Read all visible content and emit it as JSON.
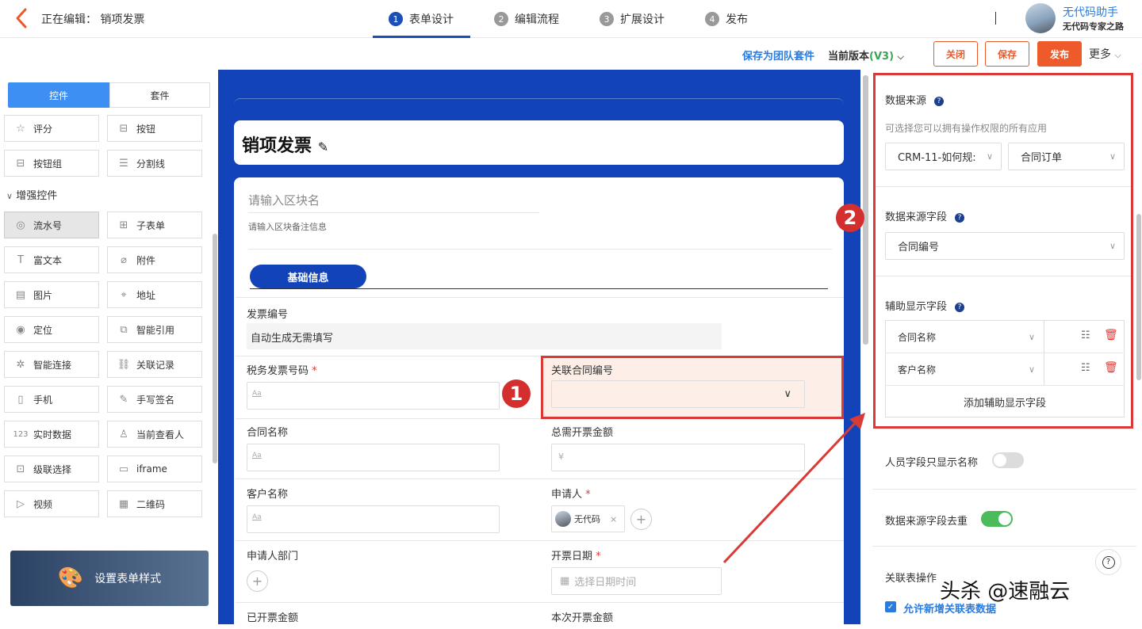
{
  "header": {
    "editing_label": "正在编辑：",
    "form_name": "销项发票",
    "steps": [
      {
        "num": "1",
        "label": "表单设计",
        "active": true
      },
      {
        "num": "2",
        "label": "编辑流程"
      },
      {
        "num": "3",
        "label": "扩展设计"
      },
      {
        "num": "4",
        "label": "发布"
      }
    ],
    "user_name": "无代码助手",
    "user_role": "无代码专家之路"
  },
  "toolbar": {
    "save_suite": "保存为团队套件",
    "version_label": "当前版本",
    "version_value": "(V3)",
    "close": "关闭",
    "save": "保存",
    "publish": "发布",
    "more": "更多"
  },
  "left_panel": {
    "tabs": [
      "控件",
      "套件"
    ],
    "top_items": [
      {
        "label": "评分",
        "icon": "star-icon"
      },
      {
        "label": "按钮",
        "icon": "button-icon"
      },
      {
        "label": "按钮组",
        "icon": "button-group-icon"
      },
      {
        "label": "分割线",
        "icon": "divider-icon"
      }
    ],
    "group_title": "增强控件",
    "items": [
      {
        "label": "流水号",
        "icon": "serial-icon"
      },
      {
        "label": "子表单",
        "icon": "subform-icon"
      },
      {
        "label": "富文本",
        "icon": "richtext-icon"
      },
      {
        "label": "附件",
        "icon": "attachment-icon"
      },
      {
        "label": "图片",
        "icon": "image-icon"
      },
      {
        "label": "地址",
        "icon": "address-icon"
      },
      {
        "label": "定位",
        "icon": "location-icon"
      },
      {
        "label": "智能引用",
        "icon": "smart-ref-icon"
      },
      {
        "label": "智能连接",
        "icon": "smart-connect-icon"
      },
      {
        "label": "关联记录",
        "icon": "link-record-icon"
      },
      {
        "label": "手机",
        "icon": "phone-icon"
      },
      {
        "label": "手写签名",
        "icon": "signature-icon"
      },
      {
        "label": "实时数据",
        "icon": "realtime-data-icon"
      },
      {
        "label": "当前查看人",
        "icon": "viewer-icon"
      },
      {
        "label": "级联选择",
        "icon": "cascade-icon"
      },
      {
        "label": "iframe",
        "icon": "iframe-icon"
      },
      {
        "label": "视频",
        "icon": "video-icon"
      },
      {
        "label": "二维码",
        "icon": "qrcode-icon"
      }
    ],
    "style_button": "设置表单样式"
  },
  "form": {
    "title": "销项发票",
    "block_name_placeholder": "请输入区块名",
    "block_note_placeholder": "请输入区块备注信息",
    "section_tab": "基础信息",
    "fields": {
      "invoice_no_label": "发票编号",
      "invoice_no_value": "自动生成无需填写",
      "tax_no_label": "税务发票号码",
      "contract_no_label": "关联合同编号",
      "contract_name_label": "合同名称",
      "total_amount_label": "总需开票金额",
      "currency_symbol": "¥",
      "customer_label": "客户名称",
      "applicant_label": "申请人",
      "applicant_value": "无代码",
      "dept_label": "申请人部门",
      "date_label": "开票日期",
      "date_placeholder": "选择日期时间",
      "issued_label": "已开票金额",
      "current_label": "本次开票金额",
      "text_placeholder": "Aa",
      "required_mark": "*"
    }
  },
  "markers": [
    "1",
    "2"
  ],
  "right_panel": {
    "data_source_label": "数据来源",
    "data_source_hint": "可选择您可以拥有操作权限的所有应用",
    "app_select": "CRM-11-如何规:",
    "form_select": "合同订单",
    "source_field_label": "数据来源字段",
    "source_field_value": "合同编号",
    "aux_label": "辅助显示字段",
    "aux_fields": [
      "合同名称",
      "客户名称"
    ],
    "add_aux": "添加辅助显示字段",
    "person_name_only": "人员字段只显示名称",
    "dedupe": "数据来源字段去重",
    "linked_ops": "关联表操作",
    "allow_add": "允许新增关联表数据",
    "help_glyph": "?",
    "toggle_off_color": "#dcdcdc",
    "toggle_on_color": "#4cbb5b"
  },
  "watermark": "头杀 @速融云"
}
